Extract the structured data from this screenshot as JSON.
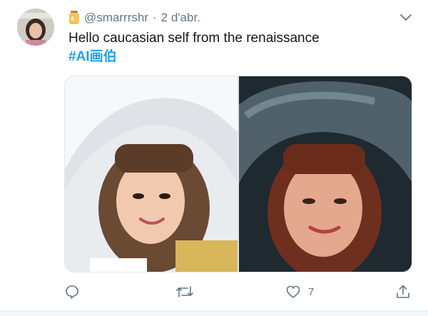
{
  "tweet": {
    "handle": "@smarrrshr",
    "separator": "·",
    "date": "2 d'abr.",
    "text": "Hello caucasian self from the renaissance",
    "hashtag": "#AI画伯"
  },
  "actions": {
    "like_count": "7"
  },
  "colors": {
    "link": "#1da1f2",
    "secondary": "#657786",
    "text": "#14171a"
  },
  "icons": {
    "badge": "jar-emoji-icon",
    "menu": "chevron-down-icon",
    "reply": "reply-icon",
    "retweet": "retweet-icon",
    "like": "heart-icon",
    "share": "share-icon"
  }
}
